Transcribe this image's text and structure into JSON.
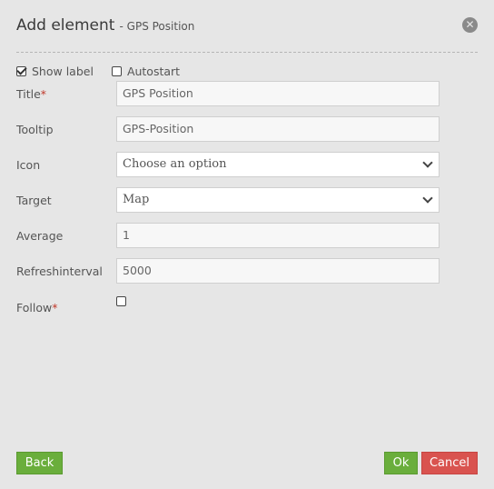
{
  "dialog": {
    "title": "Add element",
    "subtitle": "- GPS Position",
    "close_icon": "close-circle-icon"
  },
  "options": {
    "show_label": {
      "label": "Show label",
      "checked": true
    },
    "autostart": {
      "label": "Autostart",
      "checked": false
    }
  },
  "fields": {
    "title": {
      "label": "Title",
      "required": "*",
      "value": "GPS Position"
    },
    "tooltip": {
      "label": "Tooltip",
      "value": "GPS-Position"
    },
    "icon": {
      "label": "Icon",
      "value": "Choose an option"
    },
    "target": {
      "label": "Target",
      "value": "Map"
    },
    "average": {
      "label": "Average",
      "value": "1"
    },
    "refreshinterval": {
      "label": "Refreshinterval",
      "value": "5000"
    },
    "follow": {
      "label": "Follow",
      "required": "*",
      "checked": false
    }
  },
  "buttons": {
    "back": "Back",
    "ok": "Ok",
    "cancel": "Cancel"
  },
  "colors": {
    "primary": "#6aae3c",
    "danger": "#d9534f",
    "required": "#c0392b"
  }
}
